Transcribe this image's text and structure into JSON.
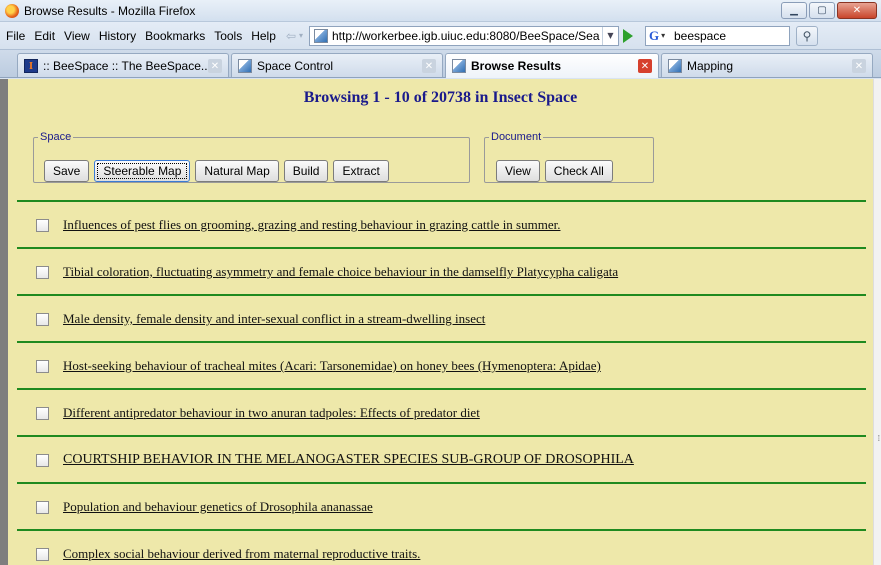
{
  "window": {
    "title": "Browse Results - Mozilla Firefox"
  },
  "menu": [
    "File",
    "Edit",
    "View",
    "History",
    "Bookmarks",
    "Tools",
    "Help"
  ],
  "urlbar": {
    "url": "http://workerbee.igb.uiuc.edu:8080/BeeSpace/Sea"
  },
  "search": {
    "engine": "G",
    "value": "beespace"
  },
  "tabs": [
    {
      "label": ":: BeeSpace :: The BeeSpace...",
      "active": false
    },
    {
      "label": "Space Control",
      "active": false
    },
    {
      "label": "Browse Results",
      "active": true
    },
    {
      "label": "Mapping",
      "active": false
    }
  ],
  "page": {
    "heading": "Browsing 1 - 10 of 20738 in Insect Space",
    "space_group": {
      "legend": "Space",
      "buttons": [
        "Save",
        "Steerable Map",
        "Natural Map",
        "Build",
        "Extract"
      ]
    },
    "document_group": {
      "legend": "Document",
      "buttons": [
        "View",
        "Check All"
      ]
    },
    "results": [
      "Influences of pest flies on grooming, grazing and resting behaviour in grazing cattle in summer.",
      "Tibial coloration, fluctuating asymmetry and female choice behaviour in the damselfly Platycypha caligata",
      "Male density, female density and inter-sexual conflict in a stream-dwelling insect",
      "Host-seeking behaviour of tracheal mites (Acari: Tarsonemidae) on honey bees (Hymenoptera: Apidae)",
      "Different antipredator behaviour in two anuran tadpoles: Effects of predator diet",
      "COURTSHIP BEHAVIOR IN THE MELANOGASTER SPECIES SUB-GROUP OF DROSOPHILA",
      "Population and behaviour genetics of Drosophila ananassae",
      "Complex social behaviour derived from maternal reproductive traits."
    ]
  }
}
